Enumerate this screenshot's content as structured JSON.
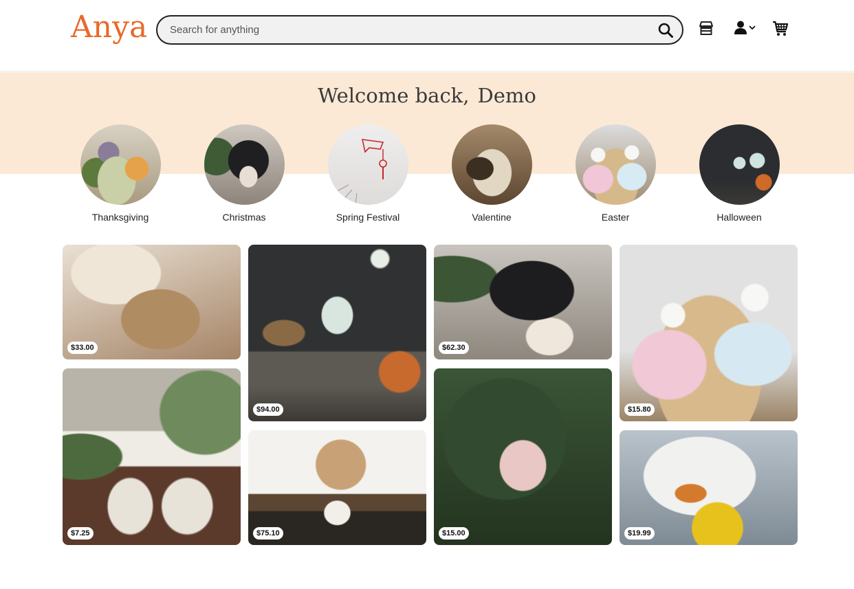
{
  "header": {
    "logo": "Anya",
    "search_placeholder": "Search for anything",
    "icons": [
      "search-icon",
      "store-icon",
      "user-icon",
      "chevron-down-icon",
      "cart-icon"
    ]
  },
  "welcome": {
    "greeting": "Welcome back,",
    "name": "Demo"
  },
  "categories": [
    {
      "label": "Thanksgiving"
    },
    {
      "label": "Christmas"
    },
    {
      "label": "Spring Festival"
    },
    {
      "label": "Valentine"
    },
    {
      "label": "Easter"
    },
    {
      "label": "Halloween"
    }
  ],
  "products": [
    {
      "price": "$33.00"
    },
    {
      "price": "$94.00"
    },
    {
      "price": "$62.30"
    },
    {
      "price": "$15.80"
    },
    {
      "price": "$7.25"
    },
    {
      "price": "$75.10"
    },
    {
      "price": "$15.00"
    },
    {
      "price": "$19.99"
    }
  ],
  "colors": {
    "brand": "#e8692a",
    "banner": "#fbe9d5"
  }
}
